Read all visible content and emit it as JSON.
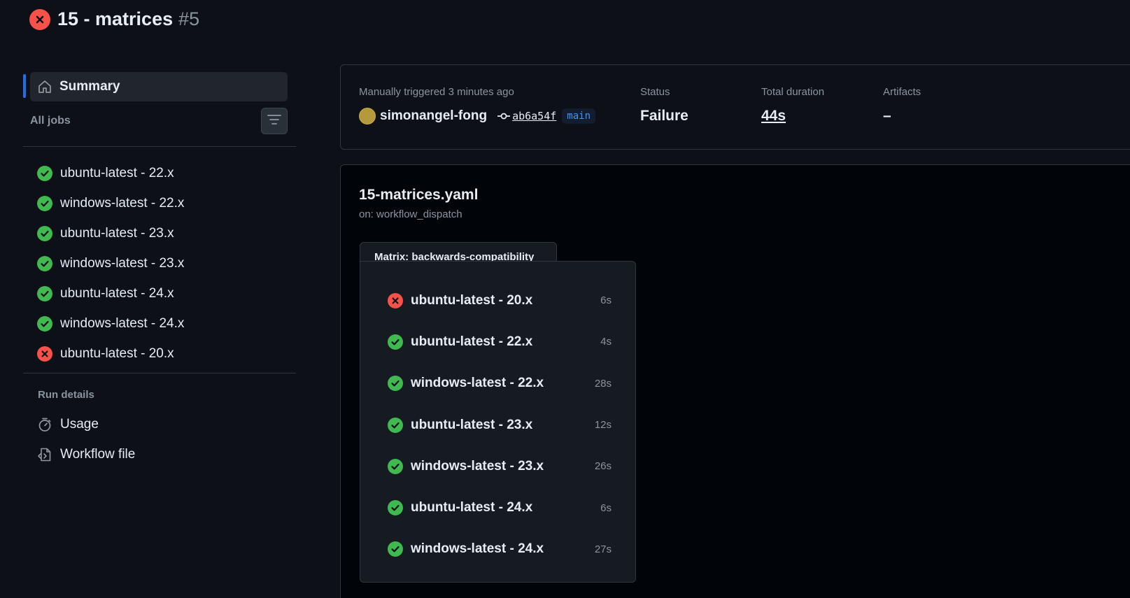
{
  "run": {
    "title": "15 - matrices",
    "number": "#5",
    "status": "failure"
  },
  "sidebar": {
    "summary_label": "Summary",
    "all_jobs_label": "All jobs",
    "jobs": [
      {
        "label": "ubuntu-latest - 22.x",
        "status": "success"
      },
      {
        "label": "windows-latest - 22.x",
        "status": "success"
      },
      {
        "label": "ubuntu-latest - 23.x",
        "status": "success"
      },
      {
        "label": "windows-latest - 23.x",
        "status": "success"
      },
      {
        "label": "ubuntu-latest - 24.x",
        "status": "success"
      },
      {
        "label": "windows-latest - 24.x",
        "status": "success"
      },
      {
        "label": "ubuntu-latest - 20.x",
        "status": "failure"
      }
    ],
    "run_details_label": "Run details",
    "usage_label": "Usage",
    "workflow_file_label": "Workflow file"
  },
  "summary": {
    "trigger": "Manually triggered 3 minutes ago",
    "actor": "simonangel-fong",
    "commit": "ab6a54f",
    "branch": "main",
    "status_label": "Status",
    "status_value": "Failure",
    "duration_label": "Total duration",
    "duration_value": "44s",
    "artifacts_label": "Artifacts",
    "artifacts_value": "–"
  },
  "workflow": {
    "file": "15-matrices.yaml",
    "trigger": "on: workflow_dispatch",
    "matrix_label": "Matrix: backwards-compatibility",
    "jobs": [
      {
        "label": "ubuntu-latest - 20.x",
        "time": "6s",
        "status": "failure"
      },
      {
        "label": "ubuntu-latest - 22.x",
        "time": "4s",
        "status": "success"
      },
      {
        "label": "windows-latest - 22.x",
        "time": "28s",
        "status": "success"
      },
      {
        "label": "ubuntu-latest - 23.x",
        "time": "12s",
        "status": "success"
      },
      {
        "label": "windows-latest - 23.x",
        "time": "26s",
        "status": "success"
      },
      {
        "label": "ubuntu-latest - 24.x",
        "time": "6s",
        "status": "success"
      },
      {
        "label": "windows-latest - 24.x",
        "time": "27s",
        "status": "success"
      }
    ]
  },
  "colors": {
    "success": "#3fb950",
    "failure": "#f85149",
    "accent": "#1f6feb",
    "branch": "#4493f8"
  },
  "icons": {
    "success": "check-circle-icon",
    "failure": "x-circle-icon",
    "summary": "home-icon",
    "filter": "filter-icon",
    "usage": "stopwatch-icon",
    "workflow_file": "file-code-icon",
    "commit": "git-commit-icon"
  }
}
